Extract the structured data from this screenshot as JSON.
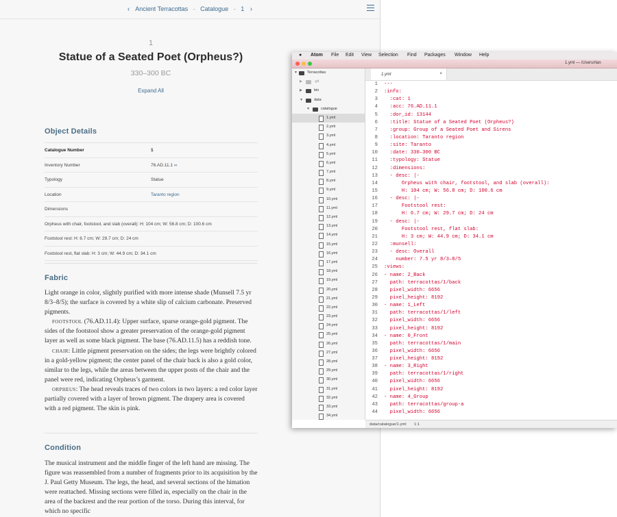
{
  "catalogue": {
    "breadcrumb": {
      "collection": "Ancient Terracottas",
      "section": "Catalogue",
      "number": "1"
    },
    "entry_number": "1",
    "title": "Statue of a Seated Poet (Orpheus?)",
    "date": "330–300 BC",
    "expand_all": "Expand All",
    "object_details": {
      "heading": "Object Details",
      "rows": [
        {
          "label": "Catalogue Number",
          "value": "1"
        },
        {
          "label": "Inventory Number",
          "value": "76.AD.11.1"
        },
        {
          "label": "Typology",
          "value": "Statue"
        },
        {
          "label": "Location",
          "value": "Taranto region"
        },
        {
          "label": "Dimensions",
          "value": ""
        },
        {
          "label": "Orpheus with chair, footstool, and slab (overall): H: 104 cm; W: 56.8 cm; D: 100.6 cm",
          "value": ""
        },
        {
          "label": "Footstool rest: H: 6.7 cm; W: 29.7 cm; D: 24 cm",
          "value": ""
        },
        {
          "label": "Footstool rest, flat slab: H: 3 cm; W: 44.9 cm; D: 34.1 cm",
          "value": ""
        }
      ]
    },
    "fabric": {
      "heading": "Fabric",
      "p1": "Light orange in color, slightly purified with more intense shade (Munsell 7.5 yr 8/3–8/5); the surface is covered by a white slip of calcium carbonate. Preserved pigments.",
      "p2_label": "Footstool",
      "p2": " (76.AD.11.4): Upper surface, sparse orange-gold pigment. The sides of the footstool show a greater preservation of the orange-gold pigment layer as well as some black pigment. The base (76.AD.11.5) has a reddish tone.",
      "p3_label": "Chair",
      "p3": ": Little pigment preservation on the sides; the legs were brightly colored in a gold-yellow pigment; the center panel of the chair back is also a gold color, similar to the legs, while the areas between the upper posts of the chair and the panel were red, indicating Orpheus’s garment.",
      "p4_label": "Orpheus",
      "p4": ": The head reveals traces of two colors in two layers: a red color layer partially covered with a layer of brown pigment. The drapery area is covered with a red pigment. The skin is pink."
    },
    "condition": {
      "heading": "Condition",
      "text": "The musical instrument and the middle finger of the left hand are missing.  The figure was reassembled from a number of fragments prior to its acquisition by the J. Paul Getty Museum. The legs, the head, and several sections of the himation were reattached. Missing sections were filled in, especially on the chair in the area of the backrest and the rear portion of the torso. During this interval, for which no specific"
    }
  },
  "atom": {
    "menu": [
      "Atom",
      "File",
      "Edit",
      "View",
      "Selection",
      "Find",
      "Packages",
      "Window",
      "Help"
    ],
    "window_title": "1.yml — /Users/rlan",
    "tree": {
      "root": "Terracottas",
      "folders": [
        ".git",
        "bin",
        "data",
        "catalogue"
      ],
      "files": [
        "1.yml",
        "2.yml",
        "3.yml",
        "4.yml",
        "5.yml",
        "6.yml",
        "7.yml",
        "8.yml",
        "9.yml",
        "10.yml",
        "11.yml",
        "12.yml",
        "13.yml",
        "14.yml",
        "15.yml",
        "16.yml",
        "17.yml",
        "18.yml",
        "19.yml",
        "20.yml",
        "21.yml",
        "22.yml",
        "23.yml",
        "24.yml",
        "25.yml",
        "26.yml",
        "27.yml",
        "28.yml",
        "29.yml",
        "30.yml",
        "31.yml",
        "32.yml",
        "33.yml",
        "34.yml",
        "35.yml"
      ]
    },
    "tab": {
      "label": "1.yml",
      "close": "×"
    },
    "code": [
      "---",
      ":info:",
      "  :cat: 1",
      "  :acc: 76.AD.11.1",
      "  :dor_id: 13144",
      "  :title: Statue of a Seated Poet (Orpheus?)",
      "  :group: Group of a Seated Poet and Sirens",
      "  :location: Taranto region",
      "  :site: Taranto",
      "  :date: 330–300 BC",
      "  :typology: Statue",
      "  :dimensions:",
      "  - desc: |-",
      "      Orpheus with chair, footstool, and slab (overall):",
      "      H: 104 cm; W: 56.8 cm; D: 100.6 cm",
      "  - desc: |-",
      "      Footstool rest:",
      "      H: 6.7 cm; W: 29.7 cm; D: 24 cm",
      "  - desc: |-",
      "      Footstool rest, flat slab:",
      "      H: 3 cm; W: 44.9 cm; D: 34.1 cm",
      "  :munsell:",
      "  - desc: Overall",
      "    number: 7.5 yr 8/3–8/5",
      ":views:",
      "- name: 2_Back",
      "  path: terracottas/1/back",
      "  pixel_width: 6656",
      "  pixel_height: 8192",
      "- name: 1_Left",
      "  path: terracottas/1/left",
      "  pixel_width: 6656",
      "  pixel_height: 8192",
      "- name: 0_Front",
      "  path: terracottas/1/main",
      "  pixel_width: 6656",
      "  pixel_height: 8192",
      "- name: 3_Right",
      "  path: terracottas/1/right",
      "  pixel_width: 6656",
      "  pixel_height: 8192",
      "- name: 4_Group",
      "  path: terracottas/group-a",
      "  pixel_width: 6656"
    ],
    "status": {
      "path": "data/catalogue/1.yml",
      "cursor": "1:1"
    }
  }
}
